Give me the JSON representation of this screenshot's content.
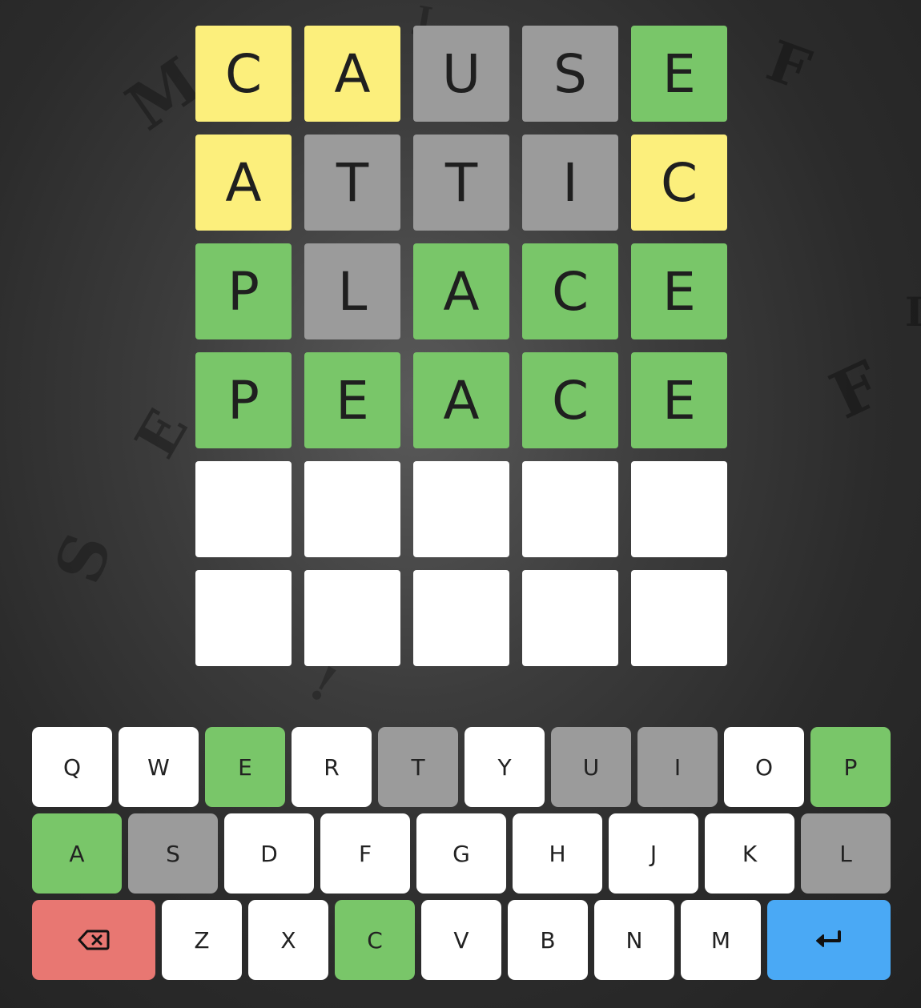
{
  "colors": {
    "correct": "#79c669",
    "present": "#fcef7c",
    "absent": "#9b9b9b",
    "empty": "#ffffff",
    "unused_key": "#ffffff",
    "delete_key": "#e87772",
    "enter_key": "#4aa9f5",
    "letter": "#1f1f1f"
  },
  "board": {
    "rows": [
      {
        "tiles": [
          {
            "letter": "C",
            "state": "present"
          },
          {
            "letter": "A",
            "state": "present"
          },
          {
            "letter": "U",
            "state": "absent"
          },
          {
            "letter": "S",
            "state": "absent"
          },
          {
            "letter": "E",
            "state": "correct"
          }
        ]
      },
      {
        "tiles": [
          {
            "letter": "A",
            "state": "present"
          },
          {
            "letter": "T",
            "state": "absent"
          },
          {
            "letter": "T",
            "state": "absent"
          },
          {
            "letter": "I",
            "state": "absent"
          },
          {
            "letter": "C",
            "state": "present"
          }
        ]
      },
      {
        "tiles": [
          {
            "letter": "P",
            "state": "correct"
          },
          {
            "letter": "L",
            "state": "absent"
          },
          {
            "letter": "A",
            "state": "correct"
          },
          {
            "letter": "C",
            "state": "correct"
          },
          {
            "letter": "E",
            "state": "correct"
          }
        ]
      },
      {
        "tiles": [
          {
            "letter": "P",
            "state": "correct"
          },
          {
            "letter": "E",
            "state": "correct"
          },
          {
            "letter": "A",
            "state": "correct"
          },
          {
            "letter": "C",
            "state": "correct"
          },
          {
            "letter": "E",
            "state": "correct"
          }
        ]
      },
      {
        "tiles": [
          {
            "letter": "",
            "state": "empty"
          },
          {
            "letter": "",
            "state": "empty"
          },
          {
            "letter": "",
            "state": "empty"
          },
          {
            "letter": "",
            "state": "empty"
          },
          {
            "letter": "",
            "state": "empty"
          }
        ]
      },
      {
        "tiles": [
          {
            "letter": "",
            "state": "empty"
          },
          {
            "letter": "",
            "state": "empty"
          },
          {
            "letter": "",
            "state": "empty"
          },
          {
            "letter": "",
            "state": "empty"
          },
          {
            "letter": "",
            "state": "empty"
          }
        ]
      }
    ]
  },
  "keyboard": {
    "rows": [
      [
        {
          "label": "Q",
          "state": "unused"
        },
        {
          "label": "W",
          "state": "unused"
        },
        {
          "label": "E",
          "state": "correct"
        },
        {
          "label": "R",
          "state": "unused"
        },
        {
          "label": "T",
          "state": "absent"
        },
        {
          "label": "Y",
          "state": "unused"
        },
        {
          "label": "U",
          "state": "absent"
        },
        {
          "label": "I",
          "state": "absent"
        },
        {
          "label": "O",
          "state": "unused"
        },
        {
          "label": "P",
          "state": "correct"
        }
      ],
      [
        {
          "label": "A",
          "state": "correct"
        },
        {
          "label": "S",
          "state": "absent"
        },
        {
          "label": "D",
          "state": "unused"
        },
        {
          "label": "F",
          "state": "unused"
        },
        {
          "label": "G",
          "state": "unused"
        },
        {
          "label": "H",
          "state": "unused"
        },
        {
          "label": "J",
          "state": "unused"
        },
        {
          "label": "K",
          "state": "unused"
        },
        {
          "label": "L",
          "state": "absent"
        }
      ],
      [
        {
          "label": "",
          "state": "delete",
          "icon": "backspace-icon"
        },
        {
          "label": "Z",
          "state": "unused"
        },
        {
          "label": "X",
          "state": "unused"
        },
        {
          "label": "C",
          "state": "correct"
        },
        {
          "label": "V",
          "state": "unused"
        },
        {
          "label": "B",
          "state": "unused"
        },
        {
          "label": "N",
          "state": "unused"
        },
        {
          "label": "M",
          "state": "unused"
        },
        {
          "label": "",
          "state": "enter",
          "icon": "enter-icon"
        }
      ]
    ]
  }
}
